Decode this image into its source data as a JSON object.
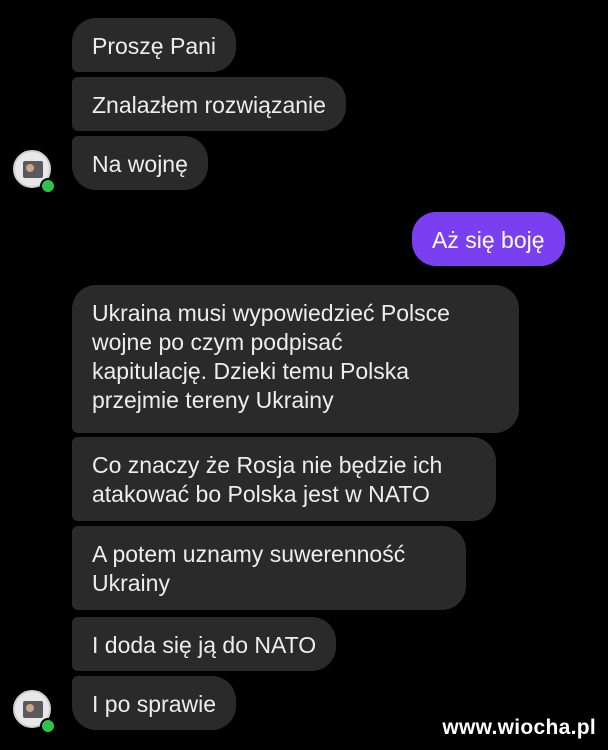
{
  "chat": {
    "messages": [
      {
        "text": "Proszę Pani"
      },
      {
        "text": "Znalazłem rozwiązanie"
      },
      {
        "text": "Na wojnę"
      },
      {
        "text": "Aż się boję"
      },
      {
        "text": "Ukraina musi wypowiedzieć Polsce\nwojne po czym podpisać\nkapitulację. Dzieki temu Polska\nprzejmie tereny Ukrainy"
      },
      {
        "text": "Co znaczy że Rosja nie będzie ich\natakować bo Polska jest w NATO"
      },
      {
        "text": "A potem uznamy suwerenność\nUkrainy"
      },
      {
        "text": "I doda się ją do NATO"
      },
      {
        "text": "I po sprawie"
      }
    ]
  },
  "colors": {
    "background": "#000000",
    "incoming_bubble": "#2a2a2a",
    "outgoing_bubble": "#7b3ff2",
    "online_dot": "#31c24d"
  },
  "watermark": {
    "text": "www.wiocha.pl"
  }
}
